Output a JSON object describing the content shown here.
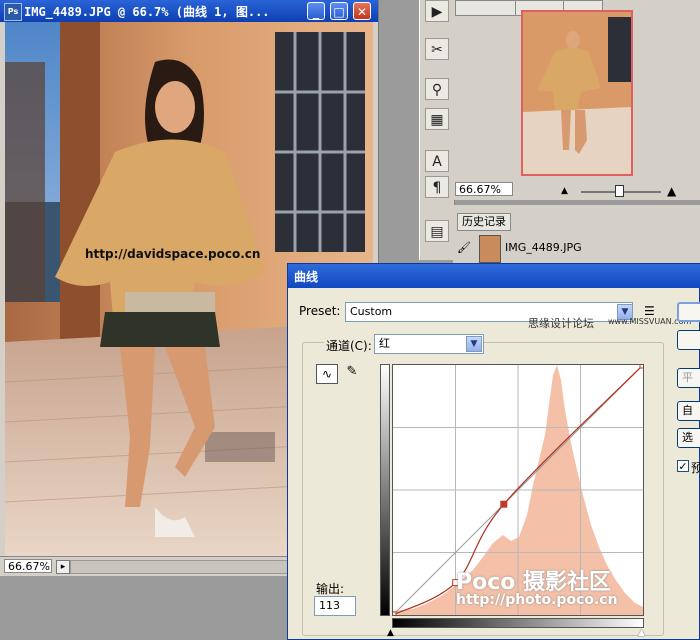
{
  "document": {
    "title": "IMG_4489.JPG @ 66.7% (曲线 1, 图...",
    "zoom": "66.67%",
    "watermark": "http://davidspace.poco.cn"
  },
  "navigator": {
    "zoom": "66.67%"
  },
  "history": {
    "tab_label": "历史记录",
    "item_label": "IMG_4489.JPG"
  },
  "curves": {
    "title": "曲线",
    "preset_label": "Preset:",
    "preset_value": "Custom",
    "channel_label": "通道(C):",
    "channel_value": "红",
    "output_label": "输出:",
    "output_value": "113",
    "preview_label": "预",
    "button_auto": "自",
    "button_options": "选",
    "button_smooth": "平",
    "curve_points": [
      [
        0,
        0
      ],
      [
        64,
        33
      ],
      [
        113,
        113
      ],
      [
        255,
        255
      ]
    ],
    "histogram_color": "#f4c0a8"
  },
  "watermarks": {
    "forum": "思缘设计论坛",
    "forum_url": "www.MISSVUAN.com",
    "poco_brand": "Poco 摄影社区",
    "poco_url": "http://photo.poco.cn"
  },
  "colors": {
    "titlebar": "#0d3fb1",
    "curve_line": "#b03020",
    "point": "#c0392b"
  }
}
